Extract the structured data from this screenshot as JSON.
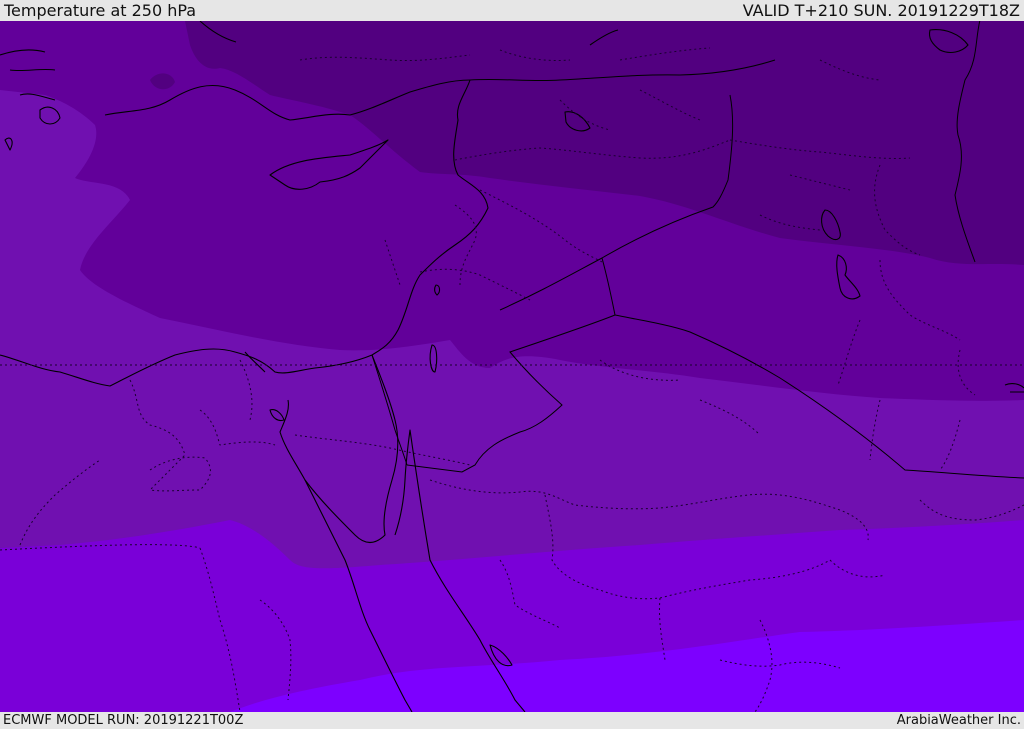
{
  "header": {
    "title": "Temperature at 250 hPa",
    "valid": "VALID T+210 SUN. 20191229T18Z"
  },
  "footer": {
    "model_run": "ECMWF MODEL RUN: 20191221T00Z",
    "credit": "ArabiaWeather Inc."
  },
  "colors": {
    "band_darkest": "#520080",
    "band_dark": "#62009a",
    "band_mid": "#7010b0",
    "band_violet": "#7a00d8",
    "band_bright": "#7d00ff",
    "band_brightest": "#8a10ff",
    "coastline": "#000000",
    "border_dotted": "#1a0030"
  },
  "icons": [
    "coastline-lines",
    "border-lines"
  ]
}
